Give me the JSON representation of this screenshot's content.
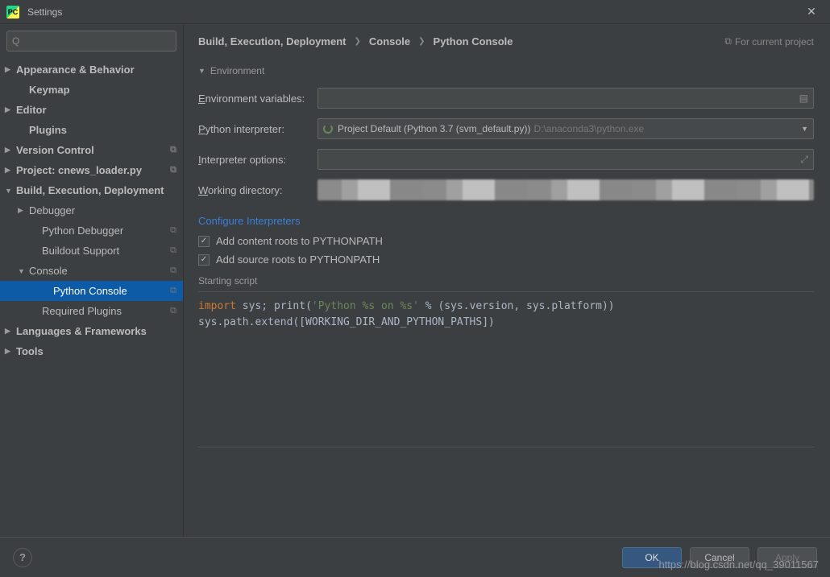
{
  "titlebar": {
    "title": "Settings"
  },
  "search": {
    "placeholder": ""
  },
  "sidebar": {
    "items": [
      {
        "label": "Appearance & Behavior",
        "bold": true,
        "arrow": "▶",
        "level": 0
      },
      {
        "label": "Keymap",
        "bold": true,
        "level": 0,
        "indent": true
      },
      {
        "label": "Editor",
        "bold": true,
        "arrow": "▶",
        "level": 0
      },
      {
        "label": "Plugins",
        "bold": true,
        "level": 0,
        "indent": true
      },
      {
        "label": "Version Control",
        "bold": true,
        "arrow": "▶",
        "level": 0,
        "copy": true
      },
      {
        "label": "Project: cnews_loader.py",
        "bold": true,
        "arrow": "▶",
        "level": 0,
        "copy": true
      },
      {
        "label": "Build, Execution, Deployment",
        "bold": true,
        "arrow": "▼",
        "level": 0
      },
      {
        "label": "Debugger",
        "arrow": "▶",
        "level": 1
      },
      {
        "label": "Python Debugger",
        "level": 2,
        "copy": true
      },
      {
        "label": "Buildout Support",
        "level": 2,
        "copy": true
      },
      {
        "label": "Console",
        "arrow": "▼",
        "level": 1,
        "copy": true
      },
      {
        "label": "Python Console",
        "level": 3,
        "copy": true,
        "selected": true
      },
      {
        "label": "Required Plugins",
        "level": 2,
        "copy": true
      },
      {
        "label": "Languages & Frameworks",
        "bold": true,
        "arrow": "▶",
        "level": 0
      },
      {
        "label": "Tools",
        "bold": true,
        "arrow": "▶",
        "level": 0
      }
    ]
  },
  "breadcrumb": {
    "parts": [
      "Build, Execution, Deployment",
      "Console",
      "Python Console"
    ],
    "note": "For current project"
  },
  "env": {
    "section": "Environment",
    "envvars_label": "Environment variables:",
    "envvars_value": "",
    "interpreter_label": "Python interpreter:",
    "interpreter_value": "Project Default (Python 3.7 (svm_default.py))",
    "interpreter_path": "D:\\anaconda3\\python.exe",
    "options_label": "Interpreter options:",
    "options_value": "",
    "workdir_label": "Working directory:",
    "workdir_value": ""
  },
  "link": "Configure Interpreters",
  "checks": {
    "content_roots": "Add content roots to PYTHONPATH",
    "source_roots": "Add source roots to PYTHONPATH"
  },
  "script": {
    "heading": "Starting script",
    "line1_kw": "import",
    "line1_a": " sys; ",
    "line1_fn": "print",
    "line1_b": "(",
    "line1_str": "'Python %s on %s'",
    "line1_c": " % (sys.version, sys.platform))",
    "line2": "sys.path.extend([WORKING_DIR_AND_PYTHON_PATHS])"
  },
  "footer": {
    "ok": "OK",
    "cancel": "Cancel",
    "apply": "Apply"
  },
  "watermark": "https://blog.csdn.net/qq_39011567"
}
